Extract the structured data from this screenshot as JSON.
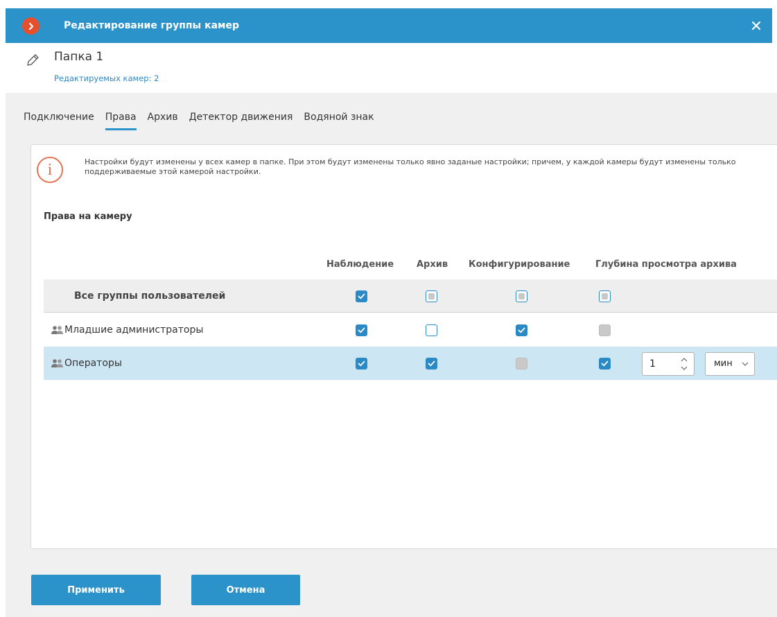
{
  "window": {
    "title": "Редактирование группы камер",
    "accent": "#2b93c9",
    "logo_color": "#e54f2b"
  },
  "header": {
    "folder_name": "Папка 1",
    "edited_count": "Редактируемых камер: 2"
  },
  "tabs": [
    {
      "label": "Подключение",
      "active": false
    },
    {
      "label": "Права",
      "active": true
    },
    {
      "label": "Архив",
      "active": false
    },
    {
      "label": "Детектор движения",
      "active": false
    },
    {
      "label": "Водяной знак",
      "active": false
    }
  ],
  "info": {
    "text": "Настройки будут изменены у всех камер в папке. При этом будут изменены только явно заданые настройки; причем, у каждой камеры будут изменены только поддерживаемые этой камерой настройки."
  },
  "rights": {
    "title": "Права на камеру",
    "columns": [
      "Наблюдение",
      "Архив",
      "Конфигурирование",
      "Глубина просмотра архива"
    ],
    "rows": [
      {
        "label": "Все группы пользователей",
        "states": [
          "checked",
          "indeterminate",
          "indeterminate",
          "indeterminate"
        ]
      },
      {
        "label": "Младшие администраторы",
        "states": [
          "checked",
          "unchecked",
          "checked",
          "disabled"
        ]
      },
      {
        "label": "Операторы",
        "states": [
          "checked",
          "checked",
          "disabled",
          "checked"
        ],
        "depth_value": "1",
        "depth_unit": "мин"
      }
    ]
  },
  "buttons": {
    "apply": "Применить",
    "cancel": "Отмена"
  }
}
